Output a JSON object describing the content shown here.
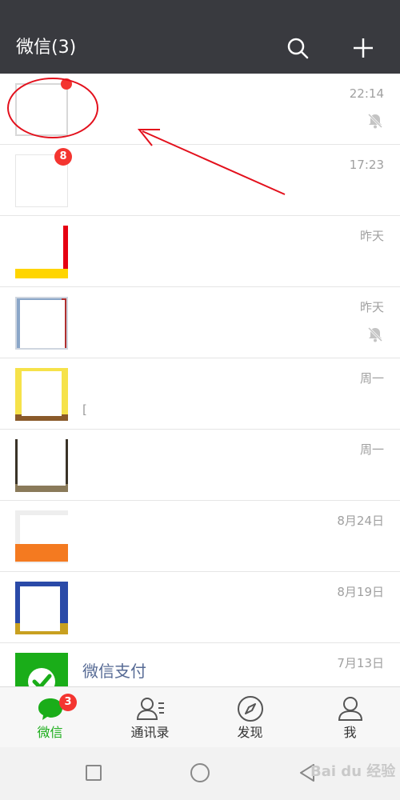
{
  "header": {
    "title": "微信(3)",
    "search_icon": "search-icon",
    "add_icon": "plus-icon",
    "background": "#393a3f"
  },
  "chats": [
    {
      "name": "",
      "preview": "",
      "time": "22:14",
      "badge": "",
      "muted": true
    },
    {
      "name": "",
      "preview": "",
      "time": "17:23",
      "badge": "8",
      "muted": false
    },
    {
      "name": "",
      "preview": "",
      "time": "昨天",
      "badge": "",
      "muted": false
    },
    {
      "name": "",
      "preview": "",
      "time": "昨天",
      "badge": "",
      "muted": true
    },
    {
      "name": "",
      "preview": "[",
      "time": "周一",
      "badge": "",
      "muted": false
    },
    {
      "name": "",
      "preview": "",
      "time": "周一",
      "badge": "",
      "muted": false
    },
    {
      "name": "",
      "preview": "",
      "time": "8月24日",
      "badge": "",
      "muted": false
    },
    {
      "name": "",
      "preview": "",
      "time": "8月19日",
      "badge": "",
      "muted": false
    },
    {
      "name": "微信支付",
      "preview": "",
      "time": "7月13日",
      "badge": "",
      "muted": false
    }
  ],
  "tabs": [
    {
      "label": "微信",
      "icon": "chat-bubble-icon",
      "active": true,
      "badge": "3"
    },
    {
      "label": "通讯录",
      "icon": "contacts-icon",
      "active": false,
      "badge": ""
    },
    {
      "label": "发现",
      "icon": "compass-icon",
      "active": false,
      "badge": ""
    },
    {
      "label": "我",
      "icon": "person-icon",
      "active": false,
      "badge": ""
    }
  ],
  "system_nav": {
    "recents_icon": "square-icon",
    "home_icon": "circle-icon",
    "back_icon": "triangle-back-icon"
  },
  "watermark": "Bai du 经验",
  "colors": {
    "accent_green": "#1aad19",
    "badge_red": "#f43530",
    "annotation_red": "#e3101c",
    "link_blue": "#576b95"
  }
}
